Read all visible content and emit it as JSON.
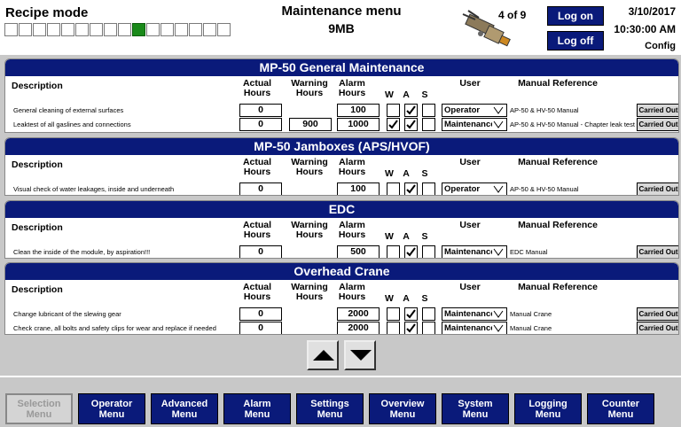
{
  "header": {
    "recipe_title": "Recipe mode",
    "recipe_slots": 16,
    "recipe_active_index": 9,
    "menu_title": "Maintenance menu",
    "menu_subtitle": "9MB",
    "page_indicator": "4 of 9",
    "logon_label": "Log on",
    "logoff_label": "Log off",
    "date": "3/10/2017",
    "time": "10:30:00 AM",
    "config_label": "Config"
  },
  "colors": {
    "title_bar": "#0a1a7a",
    "recipe_active": "#1a8a1a"
  },
  "columns": {
    "description": "Description",
    "actual": [
      "Actual",
      "Hours"
    ],
    "warning": [
      "Warning",
      "Hours"
    ],
    "alarm": [
      "Alarm",
      "Hours"
    ],
    "w": "W",
    "a": "A",
    "s": "S",
    "user": "User",
    "manual": "Manual Reference"
  },
  "sections": [
    {
      "title": "MP-50 General Maintenance",
      "rows": [
        {
          "desc": "General cleaning of external surfaces",
          "actual": "0",
          "warning": "",
          "alarm": "100",
          "w": false,
          "a": true,
          "s": false,
          "user": "Operator",
          "manual": "AP-50 & HV-50 Manual",
          "action": "Carried Out"
        },
        {
          "desc": "Leaktest of all gaslines and connections",
          "actual": "0",
          "warning": "900",
          "alarm": "1000",
          "w": true,
          "a": true,
          "s": false,
          "user": "Maintenance",
          "manual": "AP-50 & HV-50 Manual - Chapter leak test",
          "action": "Carried Out"
        }
      ]
    },
    {
      "title": "MP-50 Jamboxes (APS/HVOF)",
      "rows": [
        {
          "desc": "Visual check of water leakages, inside and underneath",
          "actual": "0",
          "warning": "",
          "alarm": "100",
          "w": false,
          "a": true,
          "s": false,
          "user": "Operator",
          "manual": "AP-50 & HV-50 Manual",
          "action": "Carried Out"
        }
      ]
    },
    {
      "title": "EDC",
      "rows": [
        {
          "desc": "Clean the inside of the module, by aspiration!!!",
          "actual": "0",
          "warning": "",
          "alarm": "500",
          "w": false,
          "a": true,
          "s": false,
          "user": "Maintenance",
          "manual": "EDC Manual",
          "action": "Carried Out"
        }
      ]
    },
    {
      "title": "Overhead Crane",
      "rows": [
        {
          "desc": "Change lubricant of the slewing gear",
          "actual": "0",
          "warning": "",
          "alarm": "2000",
          "w": false,
          "a": true,
          "s": false,
          "user": "Maintenance",
          "manual": "Manual Crane",
          "action": "Carried Out"
        },
        {
          "desc": "Check crane, all bolts and safety clips for wear and replace if needed",
          "actual": "0",
          "warning": "",
          "alarm": "2000",
          "w": false,
          "a": true,
          "s": false,
          "user": "Maintenance",
          "manual": "Manual Crane",
          "action": "Carried Out"
        }
      ]
    }
  ],
  "footer": {
    "buttons": [
      {
        "label": [
          "Selection",
          "Menu"
        ],
        "disabled": true
      },
      {
        "label": [
          "Operator",
          "Menu"
        ],
        "disabled": false
      },
      {
        "label": [
          "Advanced",
          "Menu"
        ],
        "disabled": false
      },
      {
        "label": [
          "Alarm",
          "Menu"
        ],
        "disabled": false
      },
      {
        "label": [
          "Settings",
          "Menu"
        ],
        "disabled": false
      },
      {
        "label": [
          "Overview",
          "Menu"
        ],
        "disabled": false
      },
      {
        "label": [
          "System",
          "Menu"
        ],
        "disabled": false
      },
      {
        "label": [
          "Logging",
          "Menu"
        ],
        "disabled": false
      },
      {
        "label": [
          "Counter",
          "Menu"
        ],
        "disabled": false
      }
    ]
  }
}
